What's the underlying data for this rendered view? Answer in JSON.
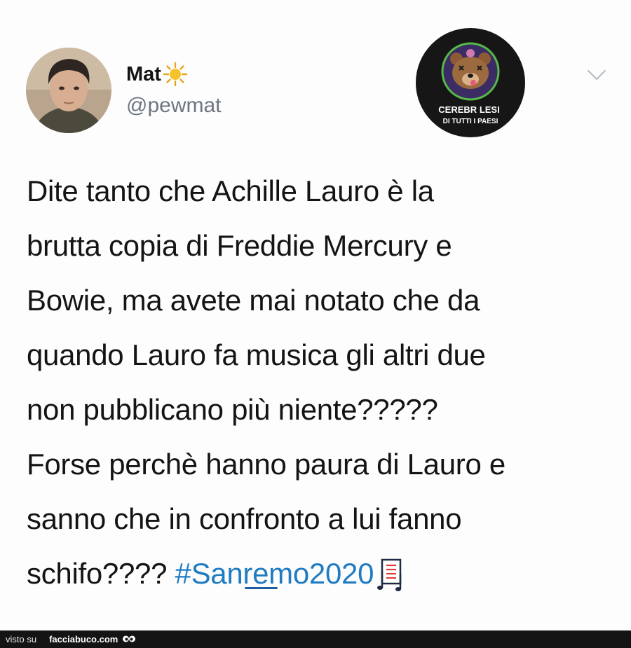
{
  "author": {
    "display_name": "Mat",
    "handle": "@pewmat",
    "avatar_icon": "profile-photo",
    "name_emoji": "sun-icon"
  },
  "watermark": {
    "text_line1": "CEREBR",
    "text_line1b": "LESI",
    "text_line2": "DI TUTTI I PAESI",
    "icon": "bear-face-icon"
  },
  "menu_icon": "chevron-down-icon",
  "tweet": {
    "lines": [
      "Dite tanto che Achille Lauro è la",
      "brutta copia di Freddie Mercury e",
      "Bowie, ma avete mai notato che da",
      "quando Lauro fa musica gli altri due",
      "non pubblicano più niente?????",
      "Forse perchè hanno paura di Lauro e",
      "sanno che in confronto a lui fanno"
    ],
    "last_line_text": "schifo???? ",
    "hashtag": "#Sanremo2020",
    "hashtag_emoji": "music-score-icon"
  },
  "footer": {
    "prefix": "visto su",
    "site": "facciabuco.com",
    "logo_icon": "eyes-icon"
  },
  "colors": {
    "hashtag": "#1f7cc2",
    "handle": "#6d7680",
    "footer_bg": "#141414"
  }
}
